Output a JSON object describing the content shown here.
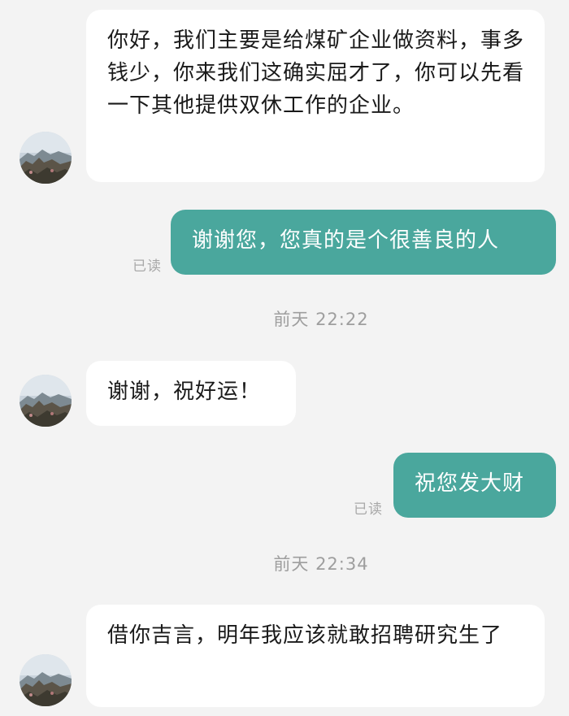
{
  "conversation": {
    "messages": [
      {
        "direction": "in",
        "text": "你好，我们主要是给煤矿企业做资料，事多钱少，你来我们这确实屈才了，你可以先看一下其他提供双休工作的企业。"
      },
      {
        "direction": "out",
        "text": "谢谢您，您真的是个很善良的人",
        "status": "已读"
      },
      {
        "direction": "in",
        "text": "谢谢，祝好运！"
      },
      {
        "direction": "out",
        "text": "祝您发大财",
        "status": "已读"
      },
      {
        "direction": "in",
        "text": "借你吉言，明年我应该就敢招聘研究生了"
      }
    ],
    "timestamps": [
      "前天 22:22",
      "前天 22:34"
    ]
  },
  "colors": {
    "background": "#f3f3f3",
    "incoming_bubble": "#ffffff",
    "outgoing_bubble": "#4aa79d",
    "outgoing_text": "#ffffff",
    "meta_text": "#9e9e9e"
  },
  "icons": {
    "contact_avatar": "mountain-landscape-avatar"
  }
}
